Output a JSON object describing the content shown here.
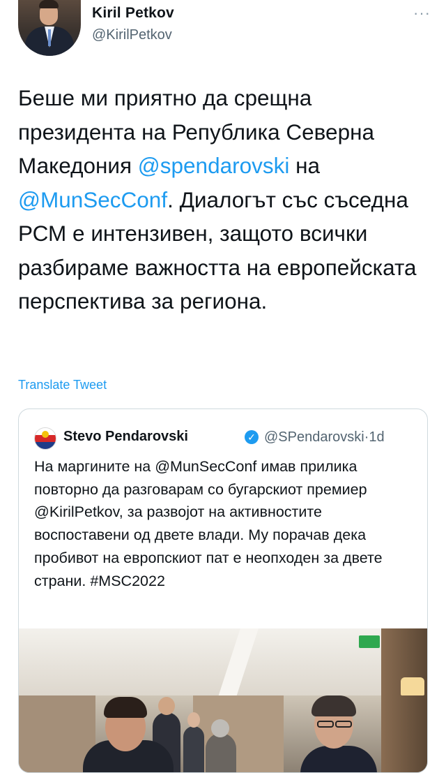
{
  "tweet": {
    "author_name": "Kiril Petkov",
    "author_handle": "@KirilPetkov",
    "more_label": "···",
    "text_parts": [
      "Беше ми приятно да срещна президента на Република Северна Македония ",
      "@spendarovski",
      " на ",
      "@MunSecConf",
      ". Диалогът със съседна РСМ е интензивен, защото всички разбираме важността на европейската перспектива за региона."
    ],
    "translate_label": "Translate Tweet"
  },
  "quoted": {
    "author_name": "Stevo Pendarovski",
    "verified_glyph": "✓",
    "author_handle": "@SPendarovski",
    "separator": "·",
    "time": "1d",
    "text": "На маргините на @MunSecConf имав прилика повторно да разговарам со бугарскиот премиер @KirilPetkov, за развојот на активностите воспоставени од двете влади. Му порачав дека пробивот на европскиот пат е неопходен за двете страни. #MSC2022"
  },
  "icons": {
    "more": "more-dots-icon",
    "verified": "verified-badge-icon"
  },
  "colors": {
    "link": "#1d9bf0",
    "text": "#0f1419",
    "secondary": "#536471",
    "border": "#cfd9de"
  }
}
